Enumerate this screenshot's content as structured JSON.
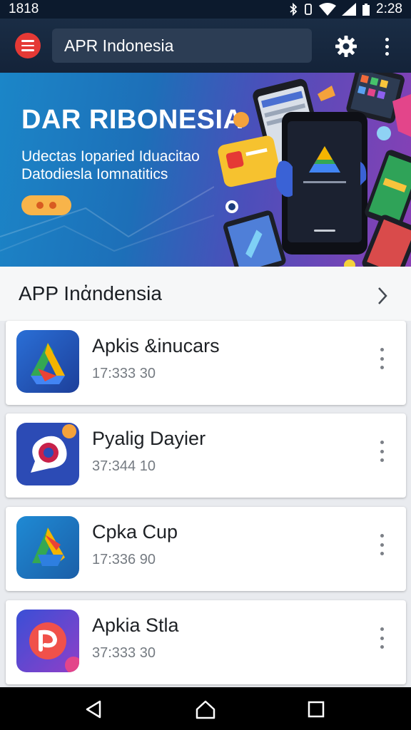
{
  "status_bar": {
    "left_text": "1818",
    "time": "2:28"
  },
  "app_bar": {
    "search_value": "APR Indonesia"
  },
  "banner": {
    "title": "DAR RIBONESIA",
    "subtitle_line1": "Udectas Ioparied Iduacitao",
    "subtitle_line2": "Datodiesla Iomnatitics"
  },
  "section": {
    "title": "APP Inἀndensia"
  },
  "apps": [
    {
      "name": "Apkis &inucars",
      "meta": "17:333  30"
    },
    {
      "name": "Pyalig Dayier",
      "meta": "37:344  10"
    },
    {
      "name": "Cpka Cup",
      "meta": "17:336  90"
    },
    {
      "name": "Apkia Stla",
      "meta": "37:333  30"
    }
  ],
  "colors": {
    "accent_red": "#e53935",
    "app_bar": "#1a2d45",
    "status_bar": "#0c1a2d"
  },
  "icons": [
    "menu-icon",
    "gear-icon",
    "more-vert-icon",
    "chevron-right-icon",
    "back-icon",
    "home-icon",
    "recents-icon"
  ]
}
